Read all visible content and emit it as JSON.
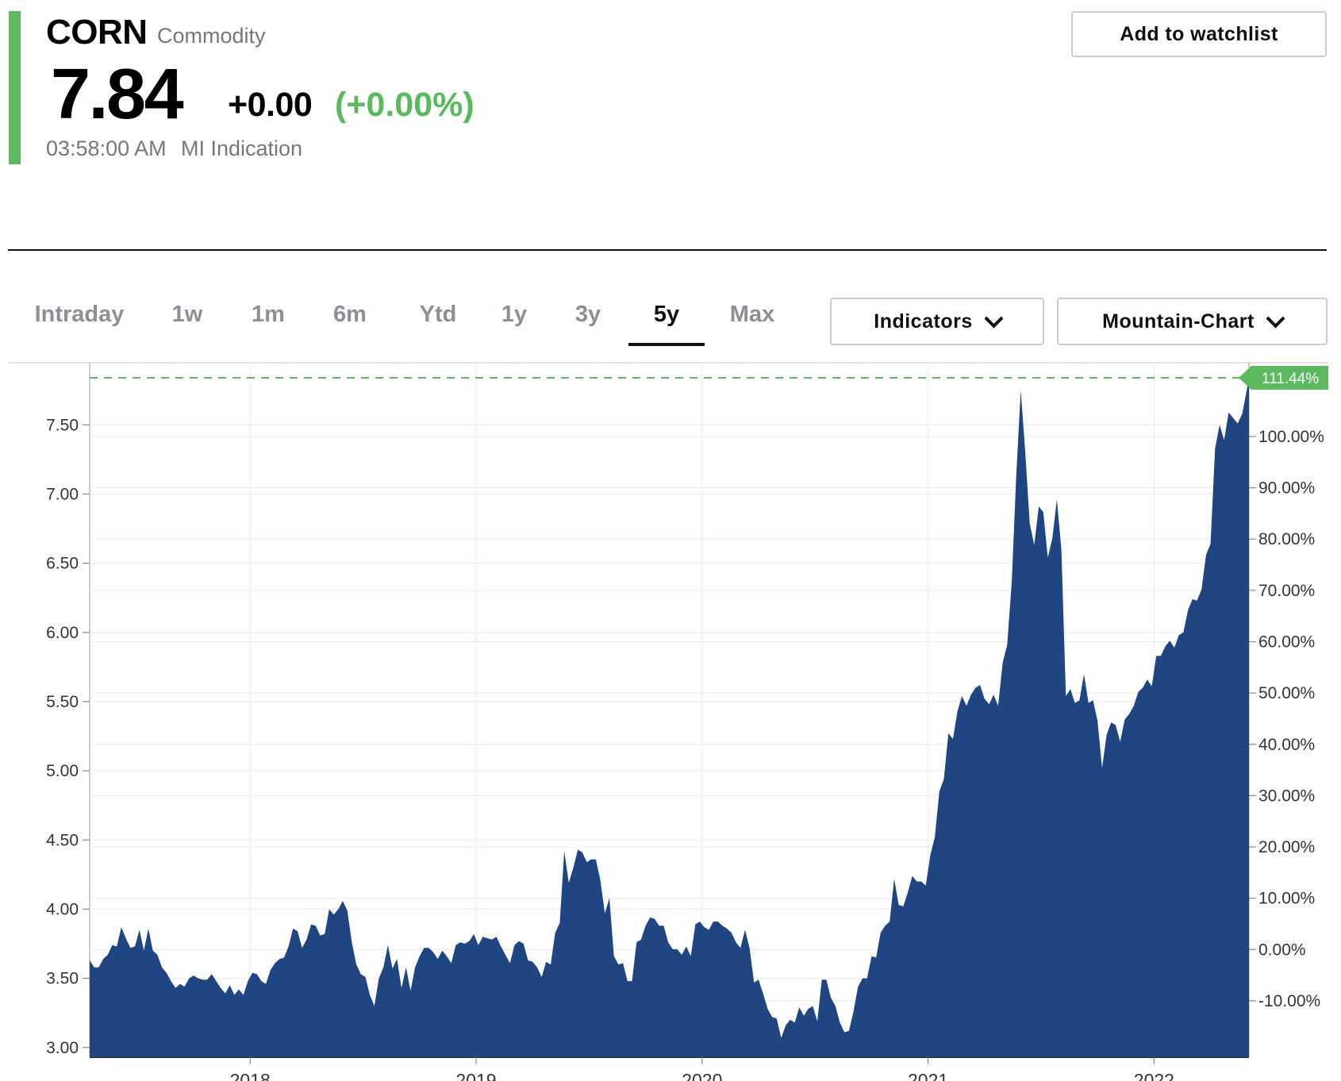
{
  "header": {
    "symbol": "CORN",
    "asset_type": "Commodity",
    "price": "7.84",
    "change": "+0.00",
    "change_pct": "(+0.00%)",
    "timestamp": "03:58:00 AM",
    "source_label": "MI Indication",
    "watchlist_button": "Add to watchlist",
    "accent_color": "#5cba5e"
  },
  "range_tabs": [
    {
      "label": "Intraday",
      "active": false
    },
    {
      "label": "1w",
      "active": false
    },
    {
      "label": "1m",
      "active": false
    },
    {
      "label": "6m",
      "active": false
    },
    {
      "label": "Ytd",
      "active": false
    },
    {
      "label": "1y",
      "active": false
    },
    {
      "label": "3y",
      "active": false
    },
    {
      "label": "5y",
      "active": true
    },
    {
      "label": "Max",
      "active": false
    }
  ],
  "controls": {
    "indicators_label": "Indicators",
    "chart_type_label": "Mountain-Chart",
    "chevron_icon": "chevron-down-icon"
  },
  "chart_data": {
    "type": "area",
    "title": "",
    "xlabel": "",
    "ylabel": "",
    "fill_color": "#1f4682",
    "reference_line_color": "#5cba5e",
    "ylim": [
      2.93,
      7.84
    ],
    "y_ticks": [
      "3.00",
      "3.50",
      "4.00",
      "4.50",
      "5.00",
      "5.50",
      "6.00",
      "6.50",
      "7.00",
      "7.50"
    ],
    "y2_ticks": [
      "-10.00%",
      "0.00%",
      "10.00%",
      "20.00%",
      "30.00%",
      "40.00%",
      "50.00%",
      "60.00%",
      "70.00%",
      "80.00%",
      "90.00%",
      "100.00%"
    ],
    "x_ticks": [
      "2018",
      "2019",
      "2020",
      "2021",
      "2022"
    ],
    "current_badge": "111.44%",
    "reference_value": 7.84,
    "baseline_value": 3.708,
    "grid": true,
    "series": [
      {
        "values": [
          [
            2017.29,
            3.63
          ],
          [
            2017.31,
            3.58
          ],
          [
            2017.33,
            3.58
          ],
          [
            2017.35,
            3.64
          ],
          [
            2017.37,
            3.67
          ],
          [
            2017.39,
            3.74
          ],
          [
            2017.41,
            3.73
          ],
          [
            2017.43,
            3.87
          ],
          [
            2017.45,
            3.79
          ],
          [
            2017.47,
            3.72
          ],
          [
            2017.49,
            3.73
          ],
          [
            2017.51,
            3.85
          ],
          [
            2017.53,
            3.7
          ],
          [
            2017.55,
            3.86
          ],
          [
            2017.57,
            3.7
          ],
          [
            2017.59,
            3.67
          ],
          [
            2017.61,
            3.58
          ],
          [
            2017.63,
            3.54
          ],
          [
            2017.65,
            3.48
          ],
          [
            2017.67,
            3.43
          ],
          [
            2017.69,
            3.46
          ],
          [
            2017.71,
            3.44
          ],
          [
            2017.73,
            3.5
          ],
          [
            2017.75,
            3.52
          ],
          [
            2017.77,
            3.5
          ],
          [
            2017.79,
            3.49
          ],
          [
            2017.81,
            3.49
          ],
          [
            2017.83,
            3.53
          ],
          [
            2017.85,
            3.48
          ],
          [
            2017.87,
            3.43
          ],
          [
            2017.89,
            3.39
          ],
          [
            2017.91,
            3.45
          ],
          [
            2017.93,
            3.38
          ],
          [
            2017.95,
            3.42
          ],
          [
            2017.97,
            3.38
          ],
          [
            2017.99,
            3.48
          ],
          [
            2018.01,
            3.54
          ],
          [
            2018.03,
            3.53
          ],
          [
            2018.05,
            3.48
          ],
          [
            2018.07,
            3.46
          ],
          [
            2018.09,
            3.56
          ],
          [
            2018.11,
            3.61
          ],
          [
            2018.13,
            3.64
          ],
          [
            2018.15,
            3.65
          ],
          [
            2018.17,
            3.73
          ],
          [
            2018.19,
            3.86
          ],
          [
            2018.21,
            3.84
          ],
          [
            2018.23,
            3.72
          ],
          [
            2018.25,
            3.78
          ],
          [
            2018.27,
            3.89
          ],
          [
            2018.29,
            3.88
          ],
          [
            2018.31,
            3.81
          ],
          [
            2018.33,
            3.82
          ],
          [
            2018.35,
            4.0
          ],
          [
            2018.37,
            3.96
          ],
          [
            2018.39,
            4.0
          ],
          [
            2018.41,
            4.06
          ],
          [
            2018.43,
            3.99
          ],
          [
            2018.45,
            3.76
          ],
          [
            2018.47,
            3.6
          ],
          [
            2018.49,
            3.53
          ],
          [
            2018.51,
            3.51
          ],
          [
            2018.53,
            3.38
          ],
          [
            2018.55,
            3.3
          ],
          [
            2018.57,
            3.5
          ],
          [
            2018.59,
            3.58
          ],
          [
            2018.61,
            3.74
          ],
          [
            2018.63,
            3.57
          ],
          [
            2018.65,
            3.64
          ],
          [
            2018.67,
            3.43
          ],
          [
            2018.69,
            3.58
          ],
          [
            2018.71,
            3.41
          ],
          [
            2018.73,
            3.58
          ],
          [
            2018.75,
            3.66
          ],
          [
            2018.77,
            3.72
          ],
          [
            2018.79,
            3.72
          ],
          [
            2018.81,
            3.69
          ],
          [
            2018.83,
            3.64
          ],
          [
            2018.85,
            3.7
          ],
          [
            2018.87,
            3.66
          ],
          [
            2018.89,
            3.61
          ],
          [
            2018.91,
            3.74
          ],
          [
            2018.93,
            3.76
          ],
          [
            2018.95,
            3.75
          ],
          [
            2018.97,
            3.77
          ],
          [
            2018.99,
            3.82
          ],
          [
            2019.01,
            3.74
          ],
          [
            2019.03,
            3.8
          ],
          [
            2019.05,
            3.79
          ],
          [
            2019.07,
            3.78
          ],
          [
            2019.09,
            3.8
          ],
          [
            2019.11,
            3.73
          ],
          [
            2019.13,
            3.67
          ],
          [
            2019.15,
            3.61
          ],
          [
            2019.17,
            3.74
          ],
          [
            2019.19,
            3.77
          ],
          [
            2019.21,
            3.75
          ],
          [
            2019.23,
            3.63
          ],
          [
            2019.25,
            3.62
          ],
          [
            2019.27,
            3.58
          ],
          [
            2019.29,
            3.51
          ],
          [
            2019.31,
            3.62
          ],
          [
            2019.33,
            3.6
          ],
          [
            2019.35,
            3.83
          ],
          [
            2019.37,
            3.9
          ],
          [
            2019.39,
            4.42
          ],
          [
            2019.41,
            4.19
          ],
          [
            2019.43,
            4.3
          ],
          [
            2019.45,
            4.43
          ],
          [
            2019.47,
            4.41
          ],
          [
            2019.49,
            4.34
          ],
          [
            2019.51,
            4.36
          ],
          [
            2019.53,
            4.36
          ],
          [
            2019.55,
            4.21
          ],
          [
            2019.57,
            3.97
          ],
          [
            2019.59,
            4.08
          ],
          [
            2019.61,
            3.66
          ],
          [
            2019.63,
            3.6
          ],
          [
            2019.65,
            3.61
          ],
          [
            2019.67,
            3.48
          ],
          [
            2019.69,
            3.48
          ],
          [
            2019.71,
            3.76
          ],
          [
            2019.73,
            3.78
          ],
          [
            2019.75,
            3.88
          ],
          [
            2019.77,
            3.94
          ],
          [
            2019.79,
            3.93
          ],
          [
            2019.81,
            3.88
          ],
          [
            2019.83,
            3.88
          ],
          [
            2019.85,
            3.76
          ],
          [
            2019.87,
            3.71
          ],
          [
            2019.89,
            3.71
          ],
          [
            2019.91,
            3.67
          ],
          [
            2019.93,
            3.73
          ],
          [
            2019.95,
            3.66
          ],
          [
            2019.97,
            3.89
          ],
          [
            2019.99,
            3.91
          ],
          [
            2020.01,
            3.87
          ],
          [
            2020.03,
            3.85
          ],
          [
            2020.05,
            3.91
          ],
          [
            2020.07,
            3.91
          ],
          [
            2020.09,
            3.88
          ],
          [
            2020.11,
            3.86
          ],
          [
            2020.13,
            3.83
          ],
          [
            2020.15,
            3.76
          ],
          [
            2020.17,
            3.72
          ],
          [
            2020.19,
            3.85
          ],
          [
            2020.21,
            3.72
          ],
          [
            2020.23,
            3.47
          ],
          [
            2020.25,
            3.49
          ],
          [
            2020.27,
            3.39
          ],
          [
            2020.29,
            3.28
          ],
          [
            2020.31,
            3.22
          ],
          [
            2020.33,
            3.21
          ],
          [
            2020.35,
            3.07
          ],
          [
            2020.37,
            3.16
          ],
          [
            2020.39,
            3.2
          ],
          [
            2020.41,
            3.18
          ],
          [
            2020.43,
            3.29
          ],
          [
            2020.45,
            3.23
          ],
          [
            2020.47,
            3.28
          ],
          [
            2020.49,
            3.3
          ],
          [
            2020.51,
            3.19
          ],
          [
            2020.53,
            3.49
          ],
          [
            2020.55,
            3.49
          ],
          [
            2020.57,
            3.36
          ],
          [
            2020.59,
            3.3
          ],
          [
            2020.61,
            3.18
          ],
          [
            2020.63,
            3.11
          ],
          [
            2020.65,
            3.12
          ],
          [
            2020.67,
            3.26
          ],
          [
            2020.69,
            3.44
          ],
          [
            2020.71,
            3.5
          ],
          [
            2020.73,
            3.5
          ],
          [
            2020.75,
            3.66
          ],
          [
            2020.77,
            3.65
          ],
          [
            2020.79,
            3.83
          ],
          [
            2020.81,
            3.88
          ],
          [
            2020.83,
            3.91
          ],
          [
            2020.85,
            4.22
          ],
          [
            2020.87,
            4.03
          ],
          [
            2020.89,
            4.02
          ],
          [
            2020.91,
            4.12
          ],
          [
            2020.93,
            4.24
          ],
          [
            2020.95,
            4.2
          ],
          [
            2020.97,
            4.2
          ],
          [
            2020.99,
            4.17
          ],
          [
            2021.01,
            4.39
          ],
          [
            2021.03,
            4.52
          ],
          [
            2021.05,
            4.85
          ],
          [
            2021.07,
            4.94
          ],
          [
            2021.09,
            5.27
          ],
          [
            2021.11,
            5.23
          ],
          [
            2021.13,
            5.43
          ],
          [
            2021.15,
            5.54
          ],
          [
            2021.17,
            5.47
          ],
          [
            2021.19,
            5.55
          ],
          [
            2021.21,
            5.6
          ],
          [
            2021.23,
            5.62
          ],
          [
            2021.25,
            5.52
          ],
          [
            2021.27,
            5.48
          ],
          [
            2021.29,
            5.55
          ],
          [
            2021.31,
            5.47
          ],
          [
            2021.33,
            5.78
          ],
          [
            2021.35,
            5.91
          ],
          [
            2021.37,
            6.36
          ],
          [
            2021.39,
            7.13
          ],
          [
            2021.41,
            7.75
          ],
          [
            2021.43,
            7.3
          ],
          [
            2021.45,
            6.79
          ],
          [
            2021.47,
            6.63
          ],
          [
            2021.49,
            6.91
          ],
          [
            2021.51,
            6.87
          ],
          [
            2021.53,
            6.54
          ],
          [
            2021.55,
            6.68
          ],
          [
            2021.57,
            6.96
          ],
          [
            2021.59,
            6.6
          ],
          [
            2021.61,
            5.54
          ],
          [
            2021.63,
            5.59
          ],
          [
            2021.65,
            5.49
          ],
          [
            2021.67,
            5.51
          ],
          [
            2021.69,
            5.7
          ],
          [
            2021.71,
            5.49
          ],
          [
            2021.73,
            5.51
          ],
          [
            2021.75,
            5.36
          ],
          [
            2021.77,
            5.02
          ],
          [
            2021.79,
            5.26
          ],
          [
            2021.81,
            5.35
          ],
          [
            2021.83,
            5.33
          ],
          [
            2021.85,
            5.21
          ],
          [
            2021.87,
            5.37
          ],
          [
            2021.89,
            5.41
          ],
          [
            2021.91,
            5.47
          ],
          [
            2021.93,
            5.57
          ],
          [
            2021.95,
            5.6
          ],
          [
            2021.97,
            5.66
          ],
          [
            2021.99,
            5.61
          ],
          [
            2022.01,
            5.83
          ],
          [
            2022.03,
            5.83
          ],
          [
            2022.05,
            5.9
          ],
          [
            2022.07,
            5.94
          ],
          [
            2022.09,
            5.89
          ],
          [
            2022.11,
            5.98
          ],
          [
            2022.13,
            6.0
          ],
          [
            2022.15,
            6.16
          ],
          [
            2022.17,
            6.24
          ],
          [
            2022.19,
            6.23
          ],
          [
            2022.21,
            6.31
          ],
          [
            2022.23,
            6.56
          ],
          [
            2022.25,
            6.64
          ],
          [
            2022.27,
            7.33
          ],
          [
            2022.29,
            7.5
          ],
          [
            2022.31,
            7.39
          ],
          [
            2022.33,
            7.59
          ],
          [
            2022.35,
            7.55
          ],
          [
            2022.37,
            7.51
          ],
          [
            2022.39,
            7.58
          ],
          [
            2022.41,
            7.75
          ],
          [
            2022.42,
            7.84
          ]
        ]
      }
    ]
  }
}
